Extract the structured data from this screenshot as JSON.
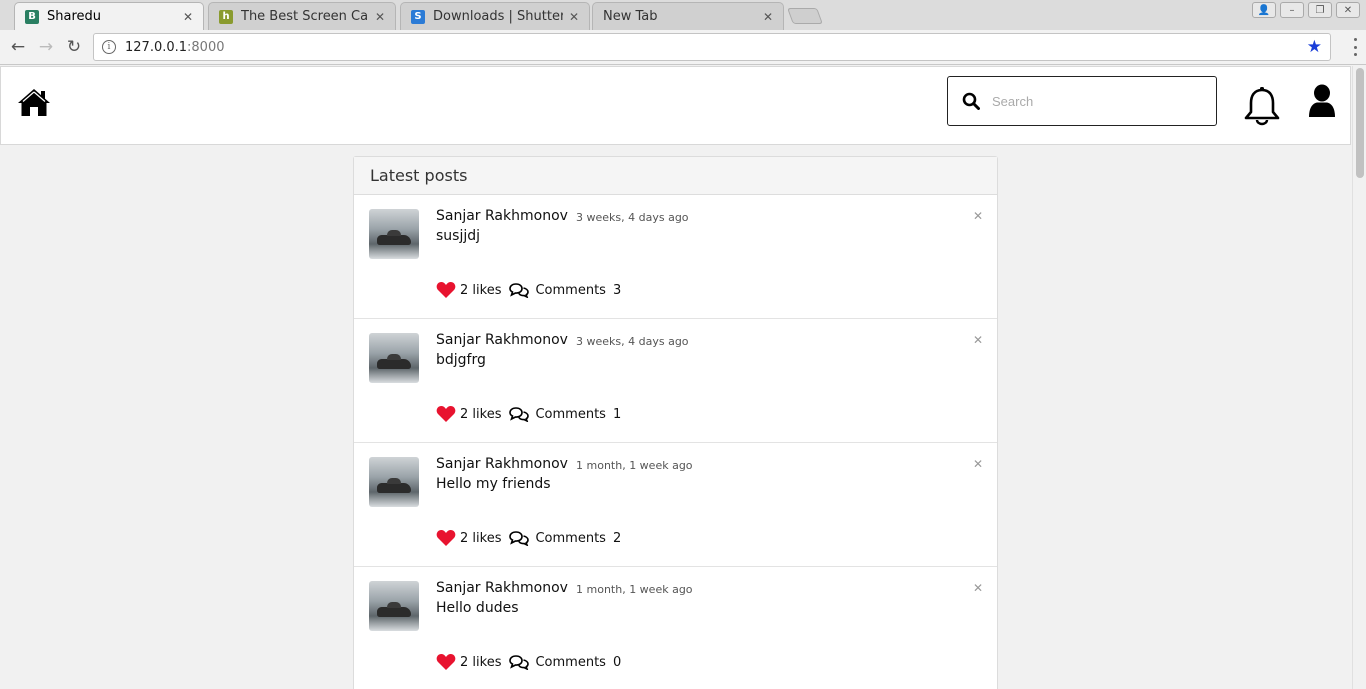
{
  "browser": {
    "tabs": [
      {
        "title": "Sharedu",
        "favicon": "B",
        "favicon_color": "#2a7f62",
        "active": true
      },
      {
        "title": "The Best Screen Captur",
        "favicon": "h",
        "favicon_color": "#8a9b2f",
        "active": false
      },
      {
        "title": "Downloads | Shutter - F",
        "favicon": "S",
        "favicon_color": "#2b7bd6",
        "active": false
      },
      {
        "title": "New Tab",
        "favicon": "",
        "favicon_color": "",
        "active": false
      }
    ],
    "address": {
      "host": "127.0.0.1",
      "port": ":8000"
    },
    "icons": {
      "back": "back-arrow-icon",
      "forward": "forward-arrow-icon",
      "reload": "reload-icon",
      "bookmark": "star-icon",
      "info": "info-icon"
    }
  },
  "header": {
    "search_placeholder": "Search",
    "icons": {
      "home": "home-icon",
      "search": "search-icon",
      "notifications": "bell-icon",
      "profile": "user-icon"
    }
  },
  "feed": {
    "title": "Latest posts",
    "colors": {
      "like": "#e8132f"
    },
    "posts": [
      {
        "author": "Sanjar Rakhmonov",
        "time": "3 weeks, 4 days ago",
        "text": "susjjdj",
        "likes": "2 likes",
        "comments_label": "Comments",
        "comments_count": "3"
      },
      {
        "author": "Sanjar Rakhmonov",
        "time": "3 weeks, 4 days ago",
        "text": "bdjgfrg",
        "likes": "2 likes",
        "comments_label": "Comments",
        "comments_count": "1"
      },
      {
        "author": "Sanjar Rakhmonov",
        "time": "1 month, 1 week ago",
        "text": "Hello my friends",
        "likes": "2 likes",
        "comments_label": "Comments",
        "comments_count": "2"
      },
      {
        "author": "Sanjar Rakhmonov",
        "time": "1 month, 1 week ago",
        "text": "Hello dudes",
        "likes": "2 likes",
        "comments_label": "Comments",
        "comments_count": "0"
      }
    ]
  }
}
